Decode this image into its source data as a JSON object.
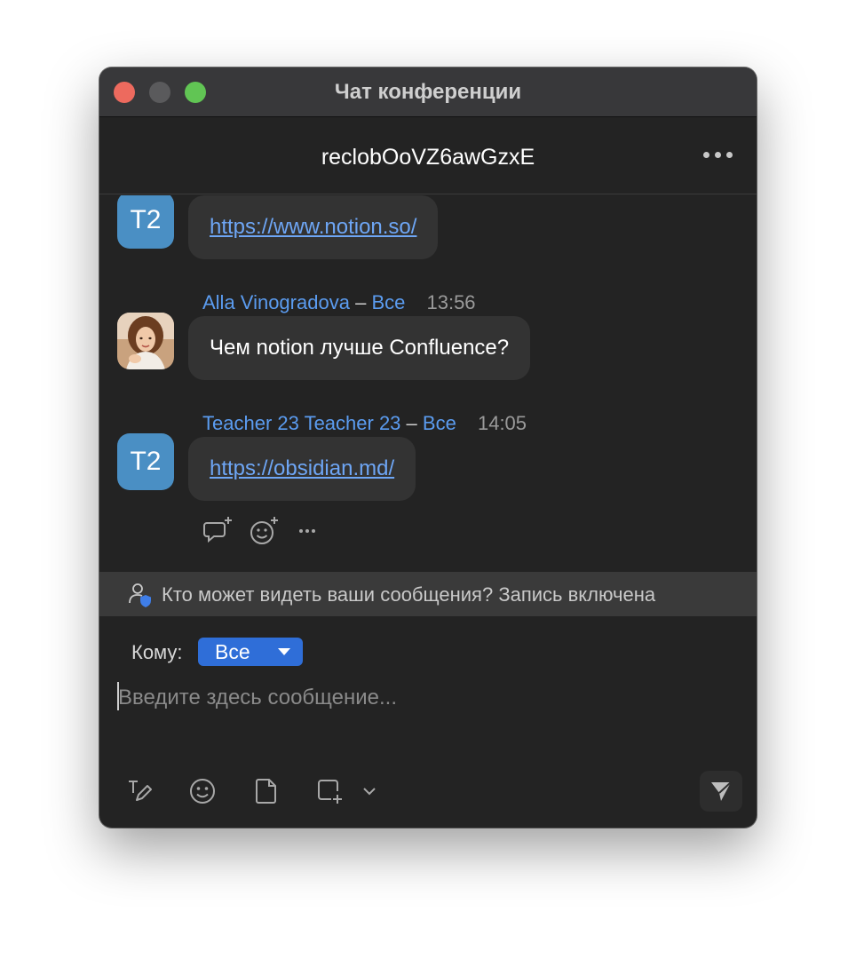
{
  "window": {
    "title": "Чат конференции"
  },
  "chat": {
    "title": "reclobOoVZ6awGzxE"
  },
  "messages": [
    {
      "avatar_text": "T2",
      "link": "https://www.notion.so/"
    },
    {
      "sender": "Alla Vinogradova",
      "separator": "–",
      "recipient": "Все",
      "time": "13:56",
      "text": "Чем notion лучше Confluence?"
    },
    {
      "avatar_text": "T2",
      "sender": "Teacher 23 Teacher 23",
      "separator": "–",
      "recipient": "Все",
      "time": "14:05",
      "link": "https://obsidian.md/"
    }
  ],
  "notice": {
    "text": "Кто может видеть ваши сообщения? Запись включена"
  },
  "composer": {
    "to_label": "Кому:",
    "to_value": "Все",
    "placeholder": "Введите здесь сообщение..."
  },
  "colors": {
    "accent": "#2f6ed8",
    "link": "#6ea6f5",
    "name": "#5b9cf0",
    "avatar": "#4a8fc4",
    "background": "#232323",
    "bubble": "#333333"
  },
  "icons": [
    "more-icon",
    "reply-icon",
    "reaction-icon",
    "message-more-icon",
    "privacy-icon",
    "format-icon",
    "emoji-icon",
    "file-icon",
    "screenshot-icon",
    "chevron-down-icon",
    "send-icon"
  ]
}
